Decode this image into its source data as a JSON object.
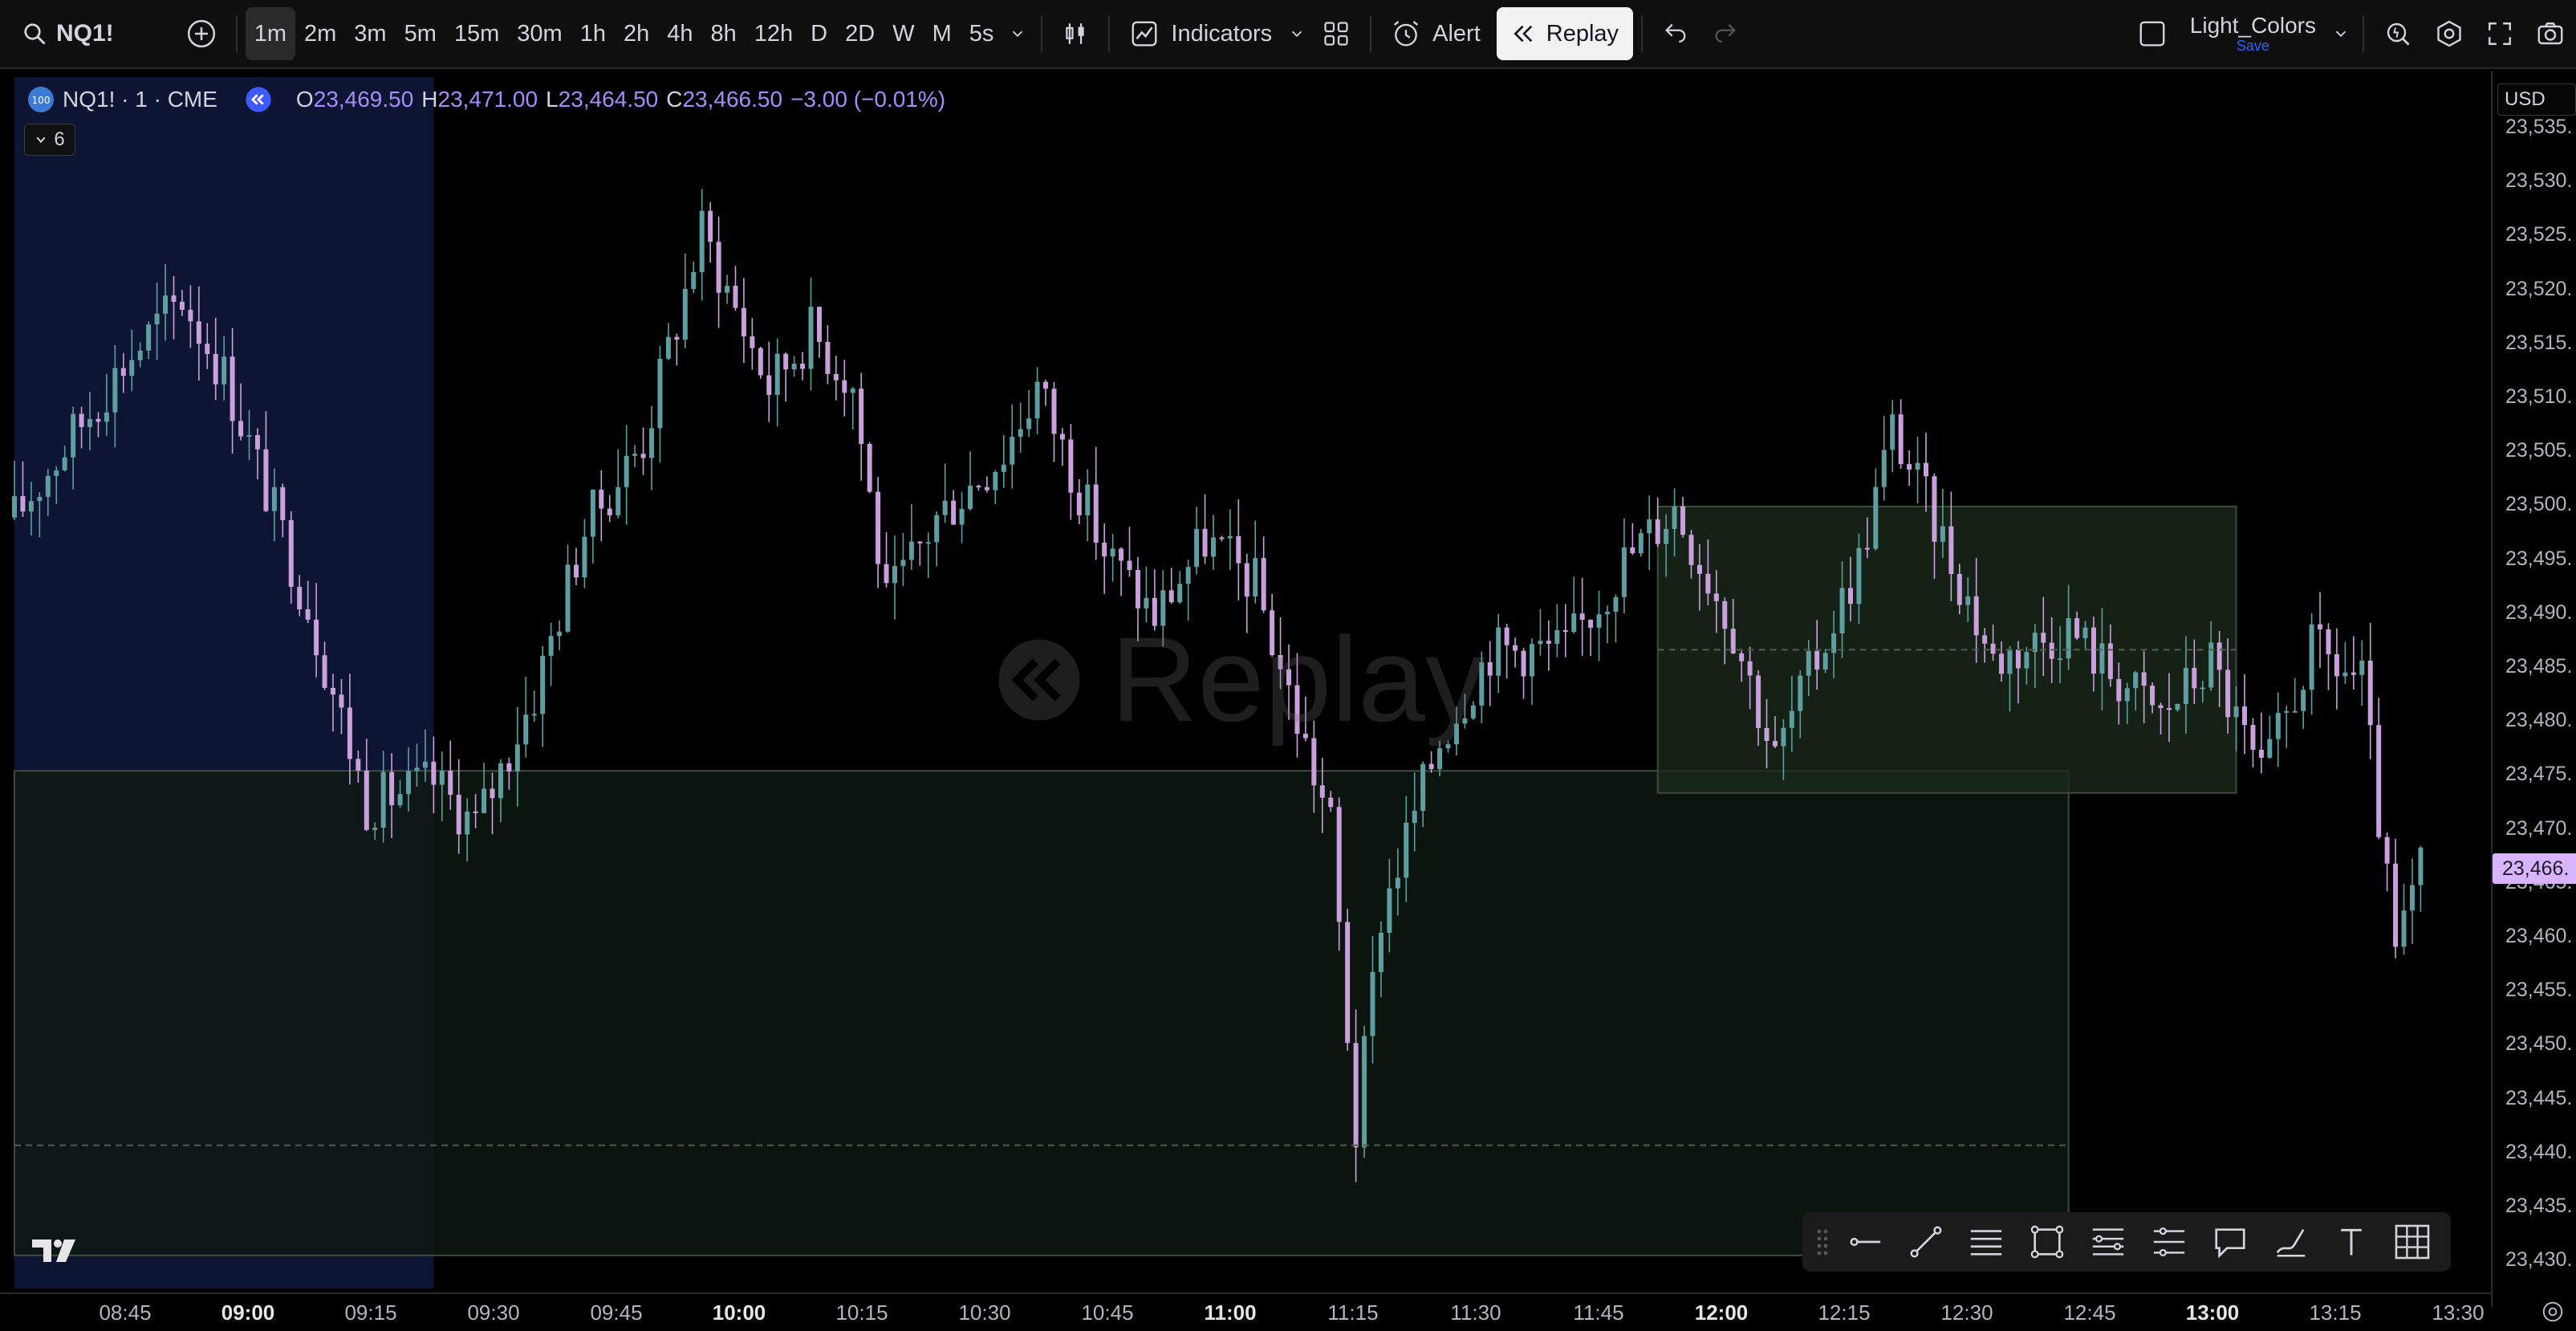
{
  "toolbar": {
    "symbol": "NQ1!",
    "timeframes": [
      "1m",
      "2m",
      "3m",
      "5m",
      "15m",
      "30m",
      "1h",
      "2h",
      "4h",
      "8h",
      "12h",
      "D",
      "2D",
      "W",
      "M",
      "5s"
    ],
    "active_timeframe": "1m",
    "indicators_label": "Indicators",
    "alert_label": "Alert",
    "replay_label": "Replay",
    "layout_name": "Light_Colors",
    "layout_save_label": "Save"
  },
  "legend": {
    "badge": "100",
    "title": "NQ1! · 1 · CME",
    "open_key": "O",
    "open": "23,469.50",
    "high_key": "H",
    "high": "23,471.00",
    "low_key": "L",
    "low": "23,464.50",
    "close_key": "C",
    "close": "23,466.50",
    "change": "−3.00 (−0.01%)",
    "collapsed_count": "6"
  },
  "watermark": "Replay",
  "price_axis": {
    "currency": "USD",
    "last_price": "23,466.",
    "labels": [
      "23,535.",
      "23,530.",
      "23,525.",
      "23,520.",
      "23,515.",
      "23,510.",
      "23,505.",
      "23,500.",
      "23,495.",
      "23,490.",
      "23,485.",
      "23,480.",
      "23,475.",
      "23,470.",
      "23,465.",
      "23,460.",
      "23,455.",
      "23,450.",
      "23,445.",
      "23,440.",
      "23,435.",
      "23,430."
    ]
  },
  "time_axis": {
    "labels": [
      {
        "text": "08:45",
        "major": false
      },
      {
        "text": "09:00",
        "major": true
      },
      {
        "text": "09:15",
        "major": false
      },
      {
        "text": "09:30",
        "major": false
      },
      {
        "text": "09:45",
        "major": false
      },
      {
        "text": "10:00",
        "major": true
      },
      {
        "text": "10:15",
        "major": false
      },
      {
        "text": "10:30",
        "major": false
      },
      {
        "text": "10:45",
        "major": false
      },
      {
        "text": "11:00",
        "major": true
      },
      {
        "text": "11:15",
        "major": false
      },
      {
        "text": "11:30",
        "major": false
      },
      {
        "text": "11:45",
        "major": false
      },
      {
        "text": "12:00",
        "major": true
      },
      {
        "text": "12:15",
        "major": false
      },
      {
        "text": "12:30",
        "major": false
      },
      {
        "text": "12:45",
        "major": false
      },
      {
        "text": "13:00",
        "major": true
      },
      {
        "text": "13:15",
        "major": false
      },
      {
        "text": "13:30",
        "major": false
      }
    ]
  },
  "colors": {
    "up_candle": "#5f9ea0",
    "down_candle": "#c9a0dc",
    "premarket_bg": "#0d1533",
    "zone_green": "#0f1a12",
    "box_green": "#1a2a1a",
    "last_price_bg": "#d8b4fe"
  },
  "drawing_tools": [
    "grip-icon",
    "horizontal-ray-icon",
    "trend-line-icon",
    "parallel-lines-icon",
    "rectangle-icon",
    "fib-retracement-icon",
    "fib-levels-icon",
    "callout-icon",
    "brush-icon",
    "text-icon",
    "grid-icon"
  ],
  "chart_data": {
    "type": "candlestick",
    "symbol": "NQ1!",
    "interval": "1",
    "exchange": "CME",
    "ylim": [
      23428,
      23538
    ],
    "x_range": [
      "08:40",
      "13:35"
    ],
    "ohlc_last": {
      "open": 23469.5,
      "high": 23471.0,
      "low": 23464.5,
      "close": 23466.5
    },
    "path_keypoints": [
      [
        "08:40",
        23498
      ],
      [
        "08:53",
        23512
      ],
      [
        "09:00",
        23518
      ],
      [
        "09:05",
        23511
      ],
      [
        "09:15",
        23490
      ],
      [
        "09:22",
        23472
      ],
      [
        "09:30",
        23474
      ],
      [
        "09:35",
        23470
      ],
      [
        "09:42",
        23482
      ],
      [
        "09:48",
        23497
      ],
      [
        "09:55",
        23505
      ],
      [
        "10:02",
        23524
      ],
      [
        "10:10",
        23510
      ],
      [
        "10:15",
        23515
      ],
      [
        "10:20",
        23510
      ],
      [
        "10:24",
        23490
      ],
      [
        "10:30",
        23498
      ],
      [
        "10:38",
        23504
      ],
      [
        "10:42",
        23510
      ],
      [
        "10:50",
        23495
      ],
      [
        "10:56",
        23489
      ],
      [
        "11:02",
        23496
      ],
      [
        "11:08",
        23492
      ],
      [
        "11:12",
        23482
      ],
      [
        "11:17",
        23470
      ],
      [
        "11:20",
        23442
      ],
      [
        "11:23",
        23462
      ],
      [
        "11:30",
        23478
      ],
      [
        "11:36",
        23486
      ],
      [
        "11:45",
        23486
      ],
      [
        "11:52",
        23494
      ],
      [
        "11:58",
        23499
      ],
      [
        "12:05",
        23488
      ],
      [
        "12:10",
        23476
      ],
      [
        "12:12",
        23480
      ],
      [
        "12:20",
        23494
      ],
      [
        "12:24",
        23506
      ],
      [
        "12:30",
        23496
      ],
      [
        "12:36",
        23485
      ],
      [
        "12:45",
        23488
      ],
      [
        "12:50",
        23484
      ],
      [
        "12:56",
        23480
      ],
      [
        "13:02",
        23485
      ],
      [
        "13:08",
        23474
      ],
      [
        "13:14",
        23486
      ],
      [
        "13:20",
        23483
      ],
      [
        "13:24",
        23458
      ],
      [
        "13:27",
        23466
      ]
    ],
    "zones": [
      {
        "name": "premarket-shade",
        "from": "08:40",
        "to": "09:30",
        "color": "#0d1533"
      },
      {
        "name": "range-zone",
        "from": "08:40",
        "to": "12:45",
        "top": 23475,
        "bottom": 23431,
        "midline": 23441,
        "color": "#0f1a12"
      },
      {
        "name": "consolidation-box",
        "from": "11:56",
        "to": "13:05",
        "top": 23499,
        "bottom": 23473,
        "midline": 23486,
        "color": "#1a2a1a"
      }
    ]
  }
}
